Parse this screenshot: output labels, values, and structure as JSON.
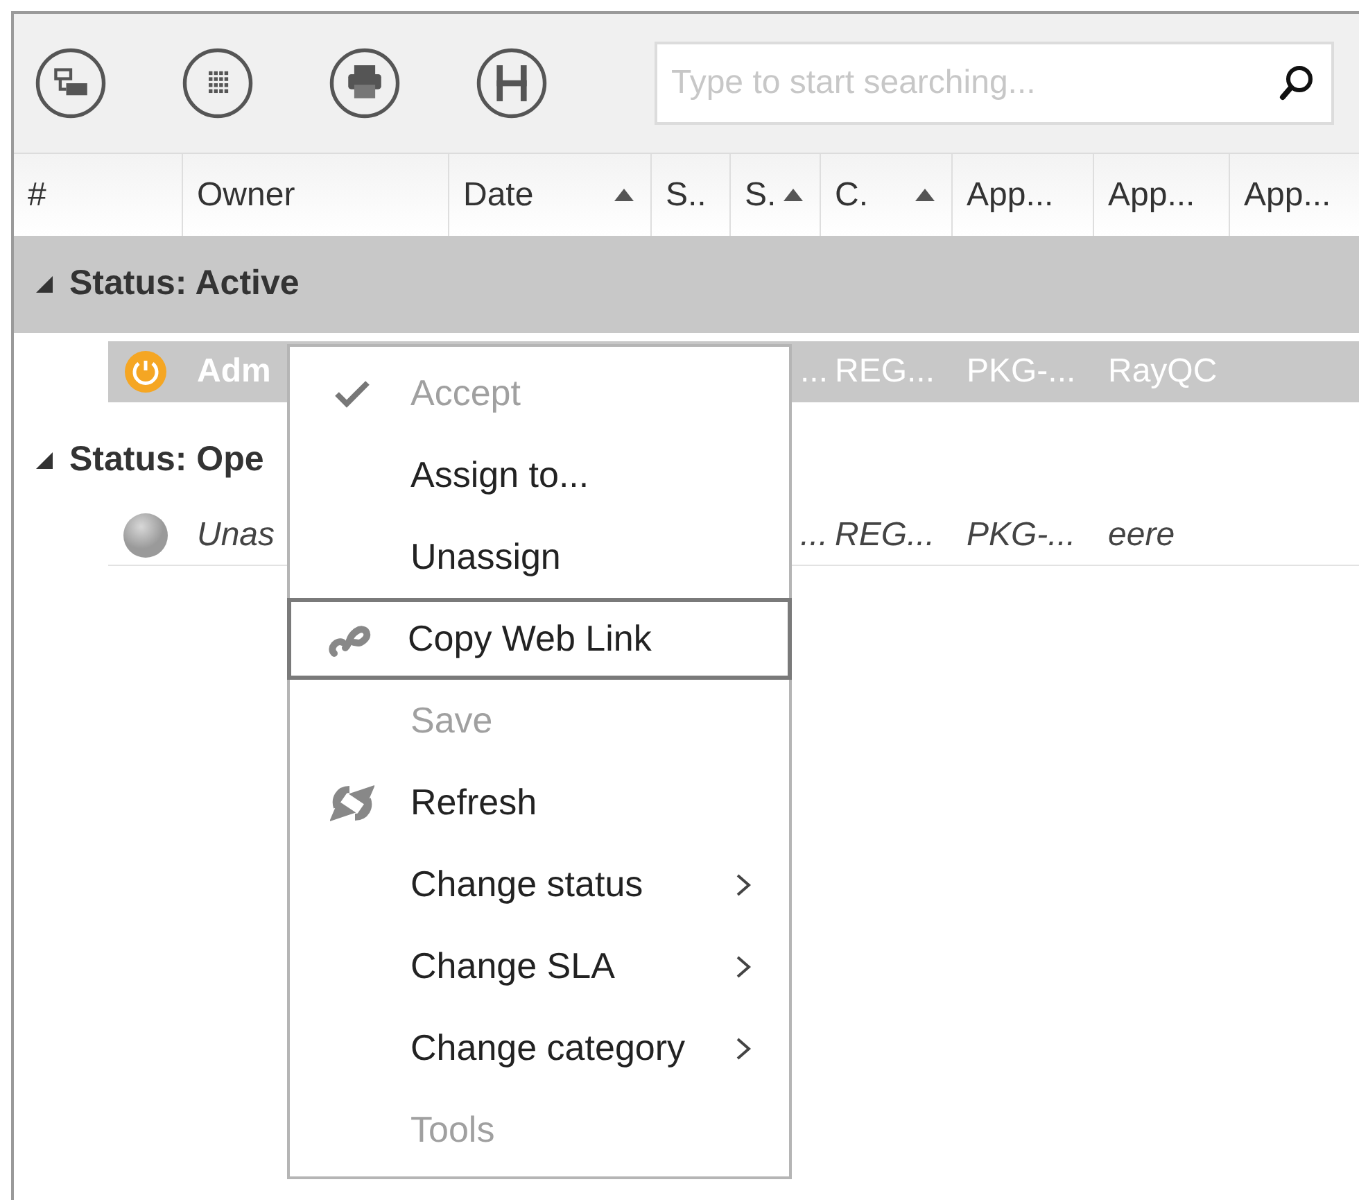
{
  "toolbar": {
    "buttons": [
      {
        "kind": "hierarchy"
      },
      {
        "kind": "grid"
      },
      {
        "kind": "print"
      },
      {
        "kind": "save"
      }
    ],
    "search": {
      "placeholder": "Type to start searching..."
    }
  },
  "table": {
    "columns": [
      {
        "label": "#",
        "sorted": false
      },
      {
        "label": "Owner",
        "sorted": false
      },
      {
        "label": "Date",
        "sorted": true
      },
      {
        "label": "S..",
        "sorted": false
      },
      {
        "label": "S.",
        "sorted": true
      },
      {
        "label": "C.",
        "sorted": true
      },
      {
        "label": "App...",
        "sorted": false
      },
      {
        "label": "App...",
        "sorted": false
      },
      {
        "label": "App...",
        "sorted": false
      }
    ],
    "groups": [
      {
        "label": "Status: Active",
        "expanded": true,
        "selected": true,
        "rows": [
          {
            "kind": "active",
            "selected": true,
            "italic": false,
            "owner": "Adm",
            "cells": [
              "...",
              "REG...",
              "PKG-...",
              "RayQC"
            ]
          }
        ]
      },
      {
        "label": "Status: Ope",
        "expanded": true,
        "selected": false,
        "rows": [
          {
            "kind": "open",
            "selected": false,
            "italic": true,
            "owner": "Unas",
            "cells": [
              "...",
              "REG...",
              "PKG-...",
              "eere"
            ]
          }
        ]
      }
    ]
  },
  "context_menu": {
    "items": [
      {
        "label": "Accept",
        "kind": "check",
        "disabled": true,
        "highlighted": false,
        "submenu": false
      },
      {
        "label": "Assign to...",
        "kind": "plain",
        "disabled": false,
        "highlighted": false,
        "submenu": false
      },
      {
        "label": "Unassign",
        "kind": "plain",
        "disabled": false,
        "highlighted": false,
        "submenu": false
      },
      {
        "label": "Copy Web Link",
        "kind": "link",
        "disabled": false,
        "highlighted": true,
        "submenu": false
      },
      {
        "label": "Save",
        "kind": "plain",
        "disabled": true,
        "highlighted": false,
        "submenu": false
      },
      {
        "label": "Refresh",
        "kind": "refresh",
        "disabled": false,
        "highlighted": false,
        "submenu": false
      },
      {
        "label": "Change status",
        "kind": "plain",
        "disabled": false,
        "highlighted": false,
        "submenu": true
      },
      {
        "label": "Change SLA",
        "kind": "plain",
        "disabled": false,
        "highlighted": false,
        "submenu": true
      },
      {
        "label": "Change category",
        "kind": "plain",
        "disabled": false,
        "highlighted": false,
        "submenu": true
      },
      {
        "label": "Tools",
        "kind": "plain",
        "disabled": true,
        "highlighted": false,
        "submenu": false
      }
    ]
  }
}
